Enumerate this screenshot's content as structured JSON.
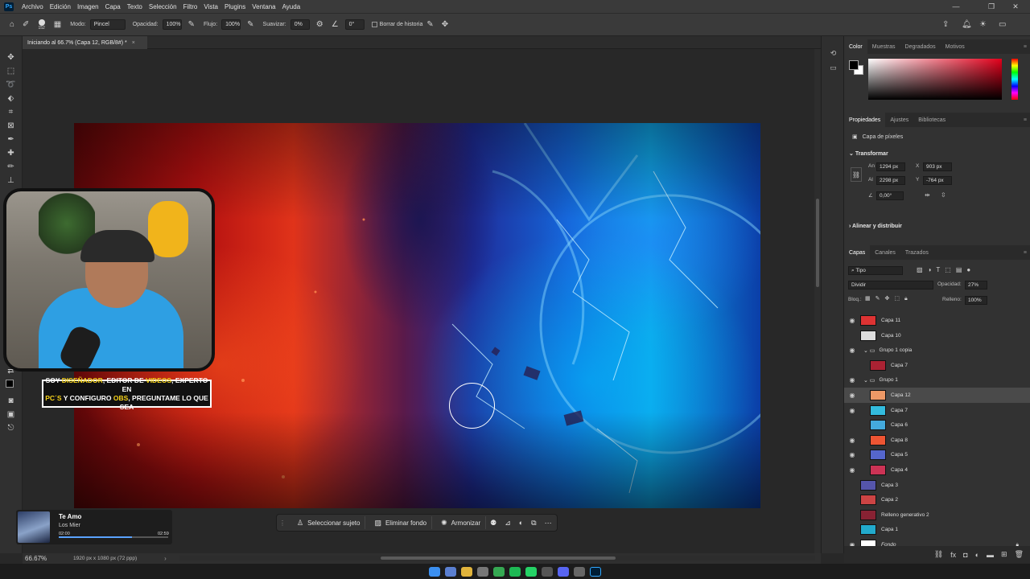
{
  "app": {
    "logo": "Ps"
  },
  "menu": [
    "Archivo",
    "Edición",
    "Imagen",
    "Capa",
    "Texto",
    "Selección",
    "Filtro",
    "Vista",
    "Plugins",
    "Ventana",
    "Ayuda"
  ],
  "options": {
    "brush_size": "152",
    "mode_label": "Modo:",
    "mode_value": "Pincel",
    "opacity_label": "Opacidad:",
    "opacity_value": "100%",
    "flow_label": "Flujo:",
    "flow_value": "100%",
    "smooth_label": "Suavizar:",
    "smooth_value": "0%",
    "angle_value": "0°",
    "erase_history_label": "Borrar de historia"
  },
  "document": {
    "tab_title": "Iniciando al 66.7% (Capa 12, RGB/8#) *"
  },
  "overlay": {
    "banner_line1_a": "SOY ",
    "banner_line1_b": "DISEÑADOR",
    "banner_line1_c": ", EDITOR DE ",
    "banner_line1_d": "VIDEOS",
    "banner_line1_e": ", EXPERTO EN",
    "banner_line2_a": "PC´S",
    "banner_line2_b": " Y CONFIGURO ",
    "banner_line2_c": "OBS",
    "banner_line2_d": ", PREGUNTAME LO QUE SEA"
  },
  "music": {
    "title": "Te Amo",
    "artist": "Los Mier",
    "elapsed": "02:00",
    "total": "02:59",
    "progress": 0.67
  },
  "context_bar": {
    "select_subject": "Seleccionar sujeto",
    "remove_bg": "Eliminar fondo",
    "harmonize": "Armonizar"
  },
  "status": {
    "zoom": "66.67%",
    "doc_info": "1920 px x 1080 px (72 ppp)"
  },
  "panels": {
    "color_tabs": [
      "Color",
      "Muestras",
      "Degradados",
      "Motivos"
    ],
    "props_tabs": [
      "Propiedades",
      "Ajustes",
      "Bibliotecas"
    ],
    "layer_type": "Capa de píxeles",
    "transform_title": "Transformar",
    "w_label": "An",
    "w": "1294 px",
    "x_label": "X",
    "x": "903 px",
    "h_label": "Al",
    "h": "2298 px",
    "y_label": "Y",
    "y": "-764 px",
    "angle": "0,00°",
    "align_title": "Alinear y distribuir",
    "layers_tabs": [
      "Capas",
      "Canales",
      "Trazados"
    ],
    "filter_kind": "Tipo",
    "blend_mode": "Dividir",
    "opacity_label": "Opacidad:",
    "opacity": "27%",
    "lock_label": "Bloq.:",
    "fill_label": "Relleno:",
    "fill": "100%"
  },
  "layers": [
    {
      "name": "Capa 11",
      "visible": true,
      "indent": 0,
      "thumb": "#d33"
    },
    {
      "name": "Capa 10",
      "visible": false,
      "indent": 0,
      "thumb": "#ddd"
    },
    {
      "name": "Grupo 1 copia",
      "visible": true,
      "indent": 0,
      "group": true
    },
    {
      "name": "Capa 7",
      "visible": false,
      "indent": 1,
      "thumb": "#a23"
    },
    {
      "name": "Grupo 1",
      "visible": true,
      "indent": 0,
      "group": true
    },
    {
      "name": "Capa 12",
      "visible": true,
      "indent": 1,
      "thumb": "#e96",
      "selected": true
    },
    {
      "name": "Capa 7",
      "visible": true,
      "indent": 1,
      "thumb": "#3bd"
    },
    {
      "name": "Capa 6",
      "visible": false,
      "indent": 1,
      "thumb": "#4ad"
    },
    {
      "name": "Capa 8",
      "visible": true,
      "indent": 1,
      "thumb": "#e53"
    },
    {
      "name": "Capa 5",
      "visible": true,
      "indent": 1,
      "thumb": "#56c"
    },
    {
      "name": "Capa 4",
      "visible": true,
      "indent": 1,
      "thumb": "#c35"
    },
    {
      "name": "Capa 3",
      "visible": false,
      "indent": 0,
      "thumb": "#55a"
    },
    {
      "name": "Capa 2",
      "visible": false,
      "indent": 0,
      "thumb": "#c44"
    },
    {
      "name": "Relleno generativo 2",
      "visible": false,
      "indent": 0,
      "thumb": "#823"
    },
    {
      "name": "Capa 1",
      "visible": false,
      "indent": 0,
      "thumb": "#2ac"
    },
    {
      "name": "Fondo",
      "visible": true,
      "indent": 0,
      "thumb": "#fff",
      "italic": true
    }
  ]
}
